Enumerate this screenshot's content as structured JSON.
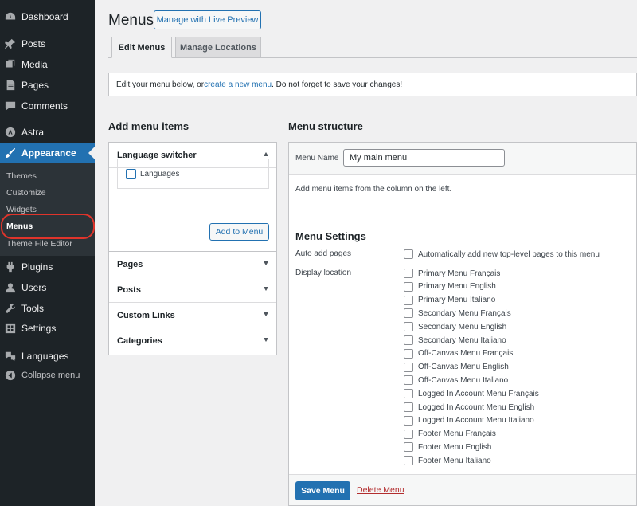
{
  "sidebar": {
    "items": [
      {
        "label": "Dashboard",
        "icon": "dashboard-icon"
      },
      {
        "label": "Posts",
        "icon": "pin-icon"
      },
      {
        "label": "Media",
        "icon": "media-icon"
      },
      {
        "label": "Pages",
        "icon": "pages-icon"
      },
      {
        "label": "Comments",
        "icon": "comment-icon"
      },
      {
        "label": "Astra",
        "icon": "astra-icon"
      },
      {
        "label": "Appearance",
        "icon": "brush-icon"
      },
      {
        "label": "Plugins",
        "icon": "plugin-icon"
      },
      {
        "label": "Users",
        "icon": "user-icon"
      },
      {
        "label": "Tools",
        "icon": "wrench-icon"
      },
      {
        "label": "Settings",
        "icon": "settings-icon"
      },
      {
        "label": "Languages",
        "icon": "translate-icon"
      },
      {
        "label": "Collapse menu",
        "icon": "collapse-icon"
      }
    ],
    "submenu": [
      "Themes",
      "Customize",
      "Widgets",
      "Menus",
      "Theme File Editor"
    ]
  },
  "header": {
    "title": "Menus",
    "live_preview_button": "Manage with Live Preview"
  },
  "tabs": [
    "Edit Menus",
    "Manage Locations"
  ],
  "notice": {
    "before": "Edit your menu below, or ",
    "link": "create a new menu",
    "after": ". Do not forget to save your changes!"
  },
  "left": {
    "title": "Add menu items",
    "language_switcher": {
      "label": "Language switcher",
      "option": "Languages",
      "add_button": "Add to Menu"
    },
    "sections": [
      "Pages",
      "Posts",
      "Custom Links",
      "Categories"
    ]
  },
  "right": {
    "title": "Menu structure",
    "menu_name_label": "Menu Name",
    "menu_name_value": "My main menu",
    "hint": "Add menu items from the column on the left.",
    "settings_title": "Menu Settings",
    "auto_add_label": "Auto add pages",
    "auto_add_option": "Automatically add new top-level pages to this menu",
    "display_location_label": "Display location",
    "locations": [
      "Primary Menu Français",
      "Primary Menu English",
      "Primary Menu Italiano",
      "Secondary Menu Français",
      "Secondary Menu English",
      "Secondary Menu Italiano",
      "Off-Canvas Menu Français",
      "Off-Canvas Menu English",
      "Off-Canvas Menu Italiano",
      "Logged In Account Menu Français",
      "Logged In Account Menu English",
      "Logged In Account Menu Italiano",
      "Footer Menu Français",
      "Footer Menu English",
      "Footer Menu Italiano"
    ],
    "save_button": "Save Menu",
    "delete_link": "Delete Menu"
  },
  "colors": {
    "sidebar_bg": "#1d2327",
    "accent": "#2271b1",
    "highlight_ring": "#e0342b",
    "danger": "#b32d2e"
  }
}
